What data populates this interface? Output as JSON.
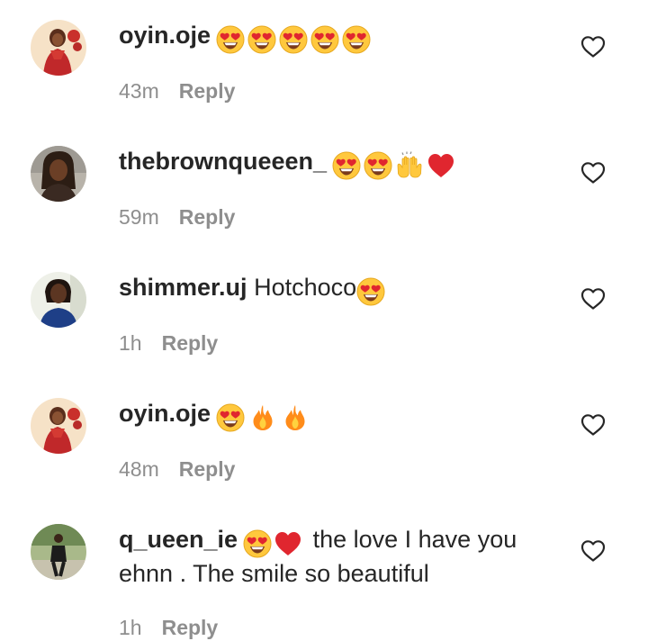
{
  "comments": [
    {
      "username": "oyin.oje",
      "text": "",
      "emojis": [
        "heart-eyes-emoji",
        "heart-eyes-emoji",
        "heart-eyes-emoji",
        "heart-eyes-emoji",
        "heart-eyes-emoji"
      ],
      "time": "43m",
      "reply_label": "Reply",
      "avatar": "avatar-oyin-oje"
    },
    {
      "username": "thebrownqueeen_",
      "text": "",
      "emojis": [
        "heart-eyes-emoji",
        "heart-eyes-emoji",
        "raised-hands-emoji",
        "red-heart-emoji"
      ],
      "time": "59m",
      "reply_label": "Reply",
      "avatar": "avatar-thebrownqueeen"
    },
    {
      "username": "shimmer.uj",
      "text": "Hotchoco",
      "emojis": [
        "heart-eyes-emoji"
      ],
      "time": "1h",
      "reply_label": "Reply",
      "avatar": "avatar-shimmer-uj"
    },
    {
      "username": "oyin.oje",
      "text": "",
      "emojis": [
        "heart-eyes-emoji",
        "fire-emoji",
        "fire-emoji"
      ],
      "time": "48m",
      "reply_label": "Reply",
      "avatar": "avatar-oyin-oje"
    },
    {
      "username": "q_ueen_ie",
      "text": "the love I have you ehnn . The smile so beautiful",
      "emojis": [
        "heart-eyes-emoji",
        "red-heart-emoji"
      ],
      "time": "1h",
      "reply_label": "Reply",
      "avatar": "avatar-q-ueen-ie"
    }
  ],
  "icons": {
    "like": "heart-outline-icon"
  },
  "colors": {
    "text": "#262626",
    "meta": "#8e8e8e",
    "emoji_face": "#ffc83d",
    "emoji_heart": "#e0262f",
    "fire_outer": "#ff8c1a"
  }
}
